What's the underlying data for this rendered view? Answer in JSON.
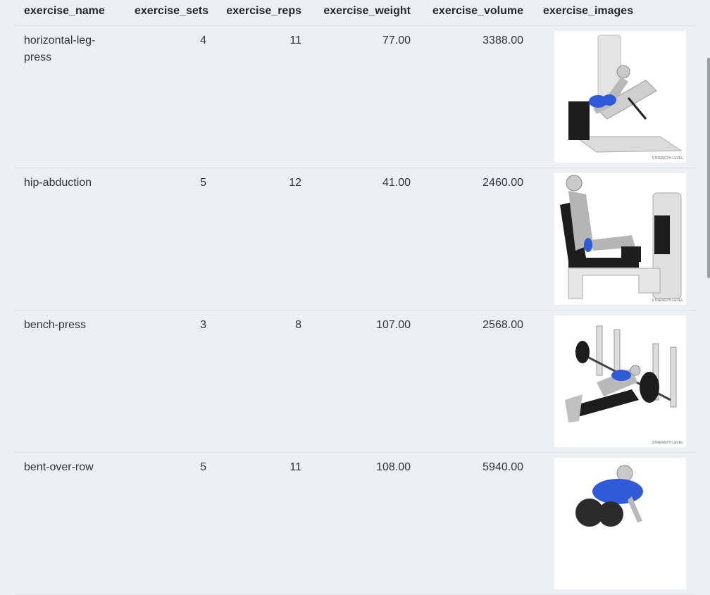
{
  "columns": [
    "exercise_name",
    "exercise_sets",
    "exercise_reps",
    "exercise_weight",
    "exercise_volume",
    "exercise_images"
  ],
  "rows": [
    {
      "name": "horizontal-leg-press",
      "sets": "4",
      "reps": "11",
      "weight": "77.00",
      "volume": "3388.00",
      "image": "leg-press-image"
    },
    {
      "name": "hip-abduction",
      "sets": "5",
      "reps": "12",
      "weight": "41.00",
      "volume": "2460.00",
      "image": "hip-abduction-image"
    },
    {
      "name": "bench-press",
      "sets": "3",
      "reps": "8",
      "weight": "107.00",
      "volume": "2568.00",
      "image": "bench-press-image"
    },
    {
      "name": "bent-over-row",
      "sets": "5",
      "reps": "11",
      "weight": "108.00",
      "volume": "5940.00",
      "image": "bent-over-row-image"
    }
  ],
  "accent_color": "#2f5bd8"
}
